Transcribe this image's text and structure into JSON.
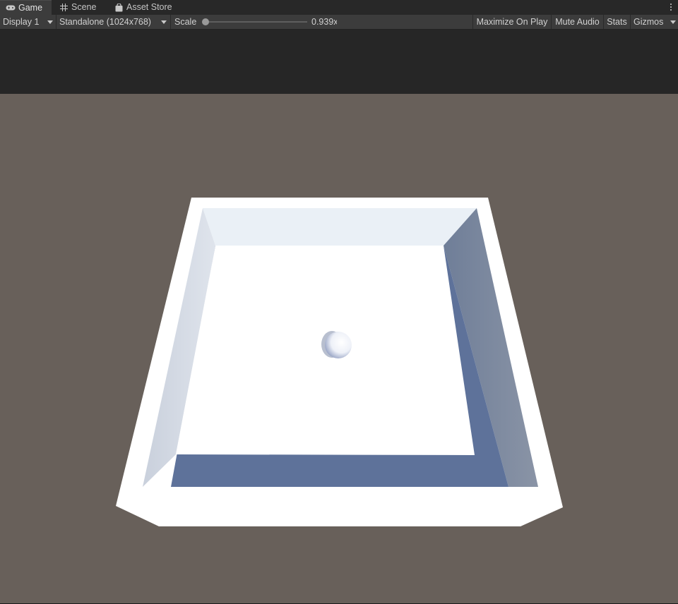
{
  "tabs": [
    {
      "label": "Game",
      "icon": "gamepad-icon",
      "active": true
    },
    {
      "label": "Scene",
      "icon": "grid-icon",
      "active": false
    },
    {
      "label": "Asset Store",
      "icon": "shopping-bag-icon",
      "active": false
    }
  ],
  "toolbar": {
    "display": "Display 1",
    "resolution": "Standalone (1024x768)",
    "scale_label": "Scale",
    "scale_value": "0.939x",
    "scale_slider_fraction": 0.02,
    "maximize_on_play": "Maximize On Play",
    "mute_audio": "Mute Audio",
    "stats": "Stats",
    "gizmos": "Gizmos"
  },
  "colors": {
    "editor_dark": "#1e1e1e",
    "toolbar_bg": "#3c3c3c",
    "tab_bg": "#282828",
    "letterbox": "#262626",
    "scene_background": "#68605a",
    "box_white": "#ffffff",
    "floor_shadow": "#5e729a"
  },
  "scene": {
    "objects": [
      "white-box-arena",
      "sphere"
    ]
  }
}
